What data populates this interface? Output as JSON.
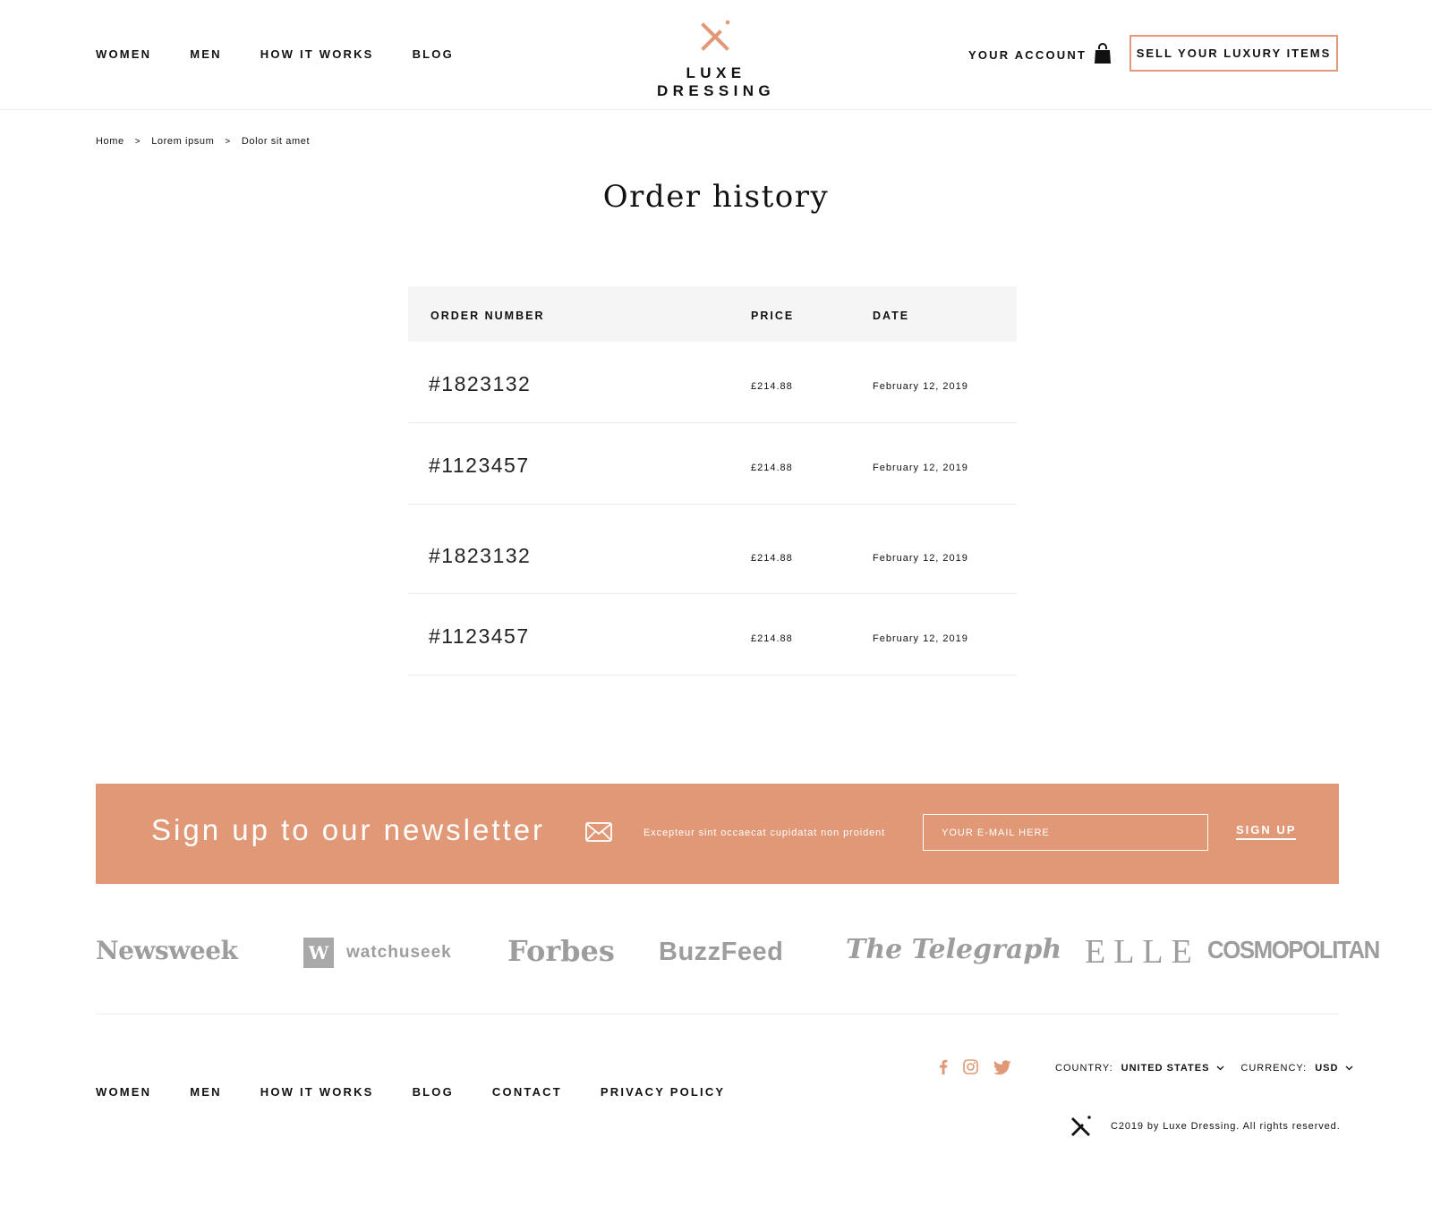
{
  "header": {
    "nav": [
      "WOMEN",
      "MEN",
      "HOW IT WORKS",
      "BLOG"
    ],
    "logo_text": "LUXE DRESSING",
    "logo_icon": "x-logo-icon",
    "account_label": "YOUR ACCOUNT",
    "bag_icon": "shopping-bag-icon",
    "sell_button": "SELL YOUR LUXURY ITEMS"
  },
  "breadcrumb": [
    "Home",
    "Lorem ipsum",
    "Dolor sit amet"
  ],
  "breadcrumb_separator": ">",
  "page_title": "Order history",
  "orders": {
    "columns": [
      "ORDER NUMBER",
      "PRICE",
      "DATE"
    ],
    "rows": [
      {
        "number": "#1823132",
        "price": "£214.88",
        "date": "February 12, 2019"
      },
      {
        "number": "#1123457",
        "price": "£214.88",
        "date": "February 12, 2019"
      },
      {
        "number": "#1823132",
        "price": "£214.88",
        "date": "February 12, 2019"
      },
      {
        "number": "#1123457",
        "price": "£214.88",
        "date": "February 12, 2019"
      }
    ]
  },
  "newsletter": {
    "title": "Sign up to our newsletter",
    "mail_icon": "envelope-icon",
    "description": "Excepteur sint occaecat cupidatat non proident",
    "input_placeholder": "YOUR E-MAIL HERE",
    "button": "SIGN UP"
  },
  "press_logos": [
    "Newsweek",
    "watchuseek",
    "Forbes",
    "BuzzFeed",
    "The Telegraph",
    "ELLE",
    "COSMOPOLITAN"
  ],
  "footer": {
    "nav": [
      "WOMEN",
      "MEN",
      "HOW IT WORKS",
      "BLOG",
      "CONTACT",
      "PRIVACY POLICY"
    ],
    "social_icons": [
      "facebook-icon",
      "instagram-icon",
      "twitter-icon"
    ],
    "country_label": "COUNTRY:",
    "country_value": "UNITED STATES",
    "currency_label": "CURRENCY:",
    "currency_value": "USD",
    "copyright": "C2019 by Luxe Dressing. All rights reserved."
  },
  "colors": {
    "accent": "#e19876",
    "text": "#111111",
    "table_header_bg": "#f5f5f5",
    "press_logo": "#9d9d9d"
  }
}
